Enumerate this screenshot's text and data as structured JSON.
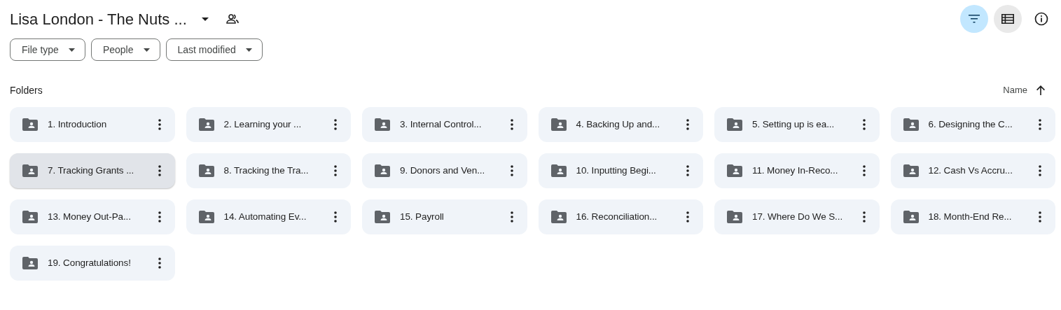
{
  "header": {
    "title": "Lisa London - The Nuts ...",
    "shared": true
  },
  "toolbar": [
    {
      "kind": "filter",
      "on": true
    },
    {
      "kind": "view",
      "on": true
    },
    {
      "kind": "info",
      "on": false
    }
  ],
  "filters": [
    {
      "label": "File type"
    },
    {
      "label": "People"
    },
    {
      "label": "Last modified"
    }
  ],
  "section": {
    "title": "Folders",
    "sort": {
      "label": "Name",
      "ascending": true
    }
  },
  "folders": [
    {
      "name": "1. Introduction",
      "selected": false
    },
    {
      "name": "2. Learning your ...",
      "selected": false
    },
    {
      "name": "3. Internal Control...",
      "selected": false
    },
    {
      "name": "4. Backing Up and...",
      "selected": false
    },
    {
      "name": "5. Setting up is ea...",
      "selected": false
    },
    {
      "name": "6. Designing the C...",
      "selected": false
    },
    {
      "name": "7. Tracking Grants ...",
      "selected": true
    },
    {
      "name": "8. Tracking the Tra...",
      "selected": false
    },
    {
      "name": "9. Donors and Ven...",
      "selected": false
    },
    {
      "name": "10. Inputting Begi...",
      "selected": false
    },
    {
      "name": "11. Money In-Reco...",
      "selected": false
    },
    {
      "name": "12. Cash Vs Accru...",
      "selected": false
    },
    {
      "name": "13. Money Out-Pa...",
      "selected": false
    },
    {
      "name": "14. Automating Ev...",
      "selected": false
    },
    {
      "name": "15. Payroll",
      "selected": false
    },
    {
      "name": "16. Reconciliation...",
      "selected": false
    },
    {
      "name": "17. Where Do We S...",
      "selected": false
    },
    {
      "name": "18. Month-End Re...",
      "selected": false
    },
    {
      "name": "19. Congratulations!",
      "selected": false
    }
  ]
}
